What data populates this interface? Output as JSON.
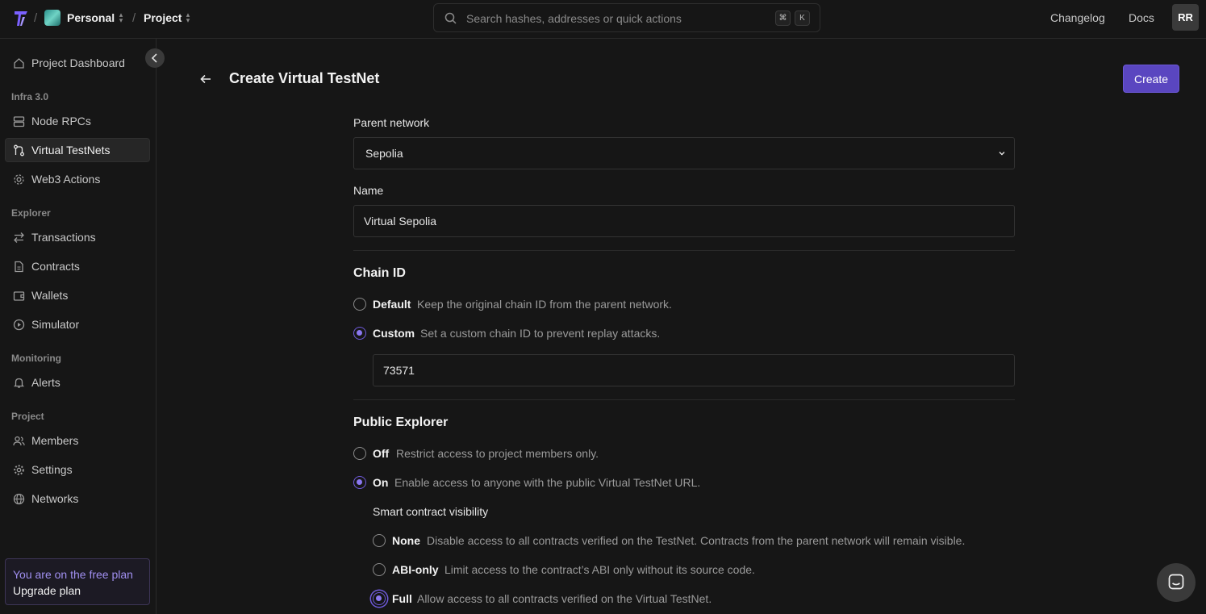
{
  "topbar": {
    "workspace": "Personal",
    "project": "Project",
    "search_placeholder": "Search hashes, addresses or quick actions",
    "kbd_cmd": "⌘",
    "kbd_k": "K",
    "changelog": "Changelog",
    "docs": "Docs",
    "user_initials": "RR"
  },
  "sidebar": {
    "dashboard": "Project Dashboard",
    "sections": {
      "infra": "Infra 3.0",
      "explorer": "Explorer",
      "monitoring": "Monitoring",
      "project": "Project"
    },
    "items": {
      "node_rpcs": "Node RPCs",
      "virtual_testnets": "Virtual TestNets",
      "web3_actions": "Web3 Actions",
      "transactions": "Transactions",
      "contracts": "Contracts",
      "wallets": "Wallets",
      "simulator": "Simulator",
      "alerts": "Alerts",
      "members": "Members",
      "settings": "Settings",
      "networks": "Networks"
    },
    "plan": {
      "notice": "You are on the free plan",
      "upgrade": "Upgrade plan"
    }
  },
  "main": {
    "title": "Create Virtual TestNet",
    "create_label": "Create",
    "parent_network_label": "Parent network",
    "parent_network_value": "Sepolia",
    "name_label": "Name",
    "name_value": "Virtual Sepolia",
    "chain_id": {
      "title": "Chain ID",
      "default_name": "Default",
      "default_desc": "Keep the original chain ID from the parent network.",
      "custom_name": "Custom",
      "custom_desc": "Set a custom chain ID to prevent replay attacks.",
      "custom_value": "73571",
      "selected": "custom"
    },
    "public_explorer": {
      "title": "Public Explorer",
      "off_name": "Off",
      "off_desc": "Restrict access to project members only.",
      "on_name": "On",
      "on_desc": "Enable access to anyone with the public Virtual TestNet URL.",
      "selected": "on",
      "visibility_label": "Smart contract visibility",
      "none_name": "None",
      "none_desc": "Disable access to all contracts verified on the TestNet. Contracts from the parent network will remain visible.",
      "abi_name": "ABI-only",
      "abi_desc": "Limit access to the contract’s ABI only without its source code.",
      "full_name": "Full",
      "full_desc": "Allow access to all contracts verified on the Virtual TestNet.",
      "visibility_selected": "full"
    }
  },
  "colors": {
    "accent": "#5a46c0",
    "background": "#161616"
  }
}
